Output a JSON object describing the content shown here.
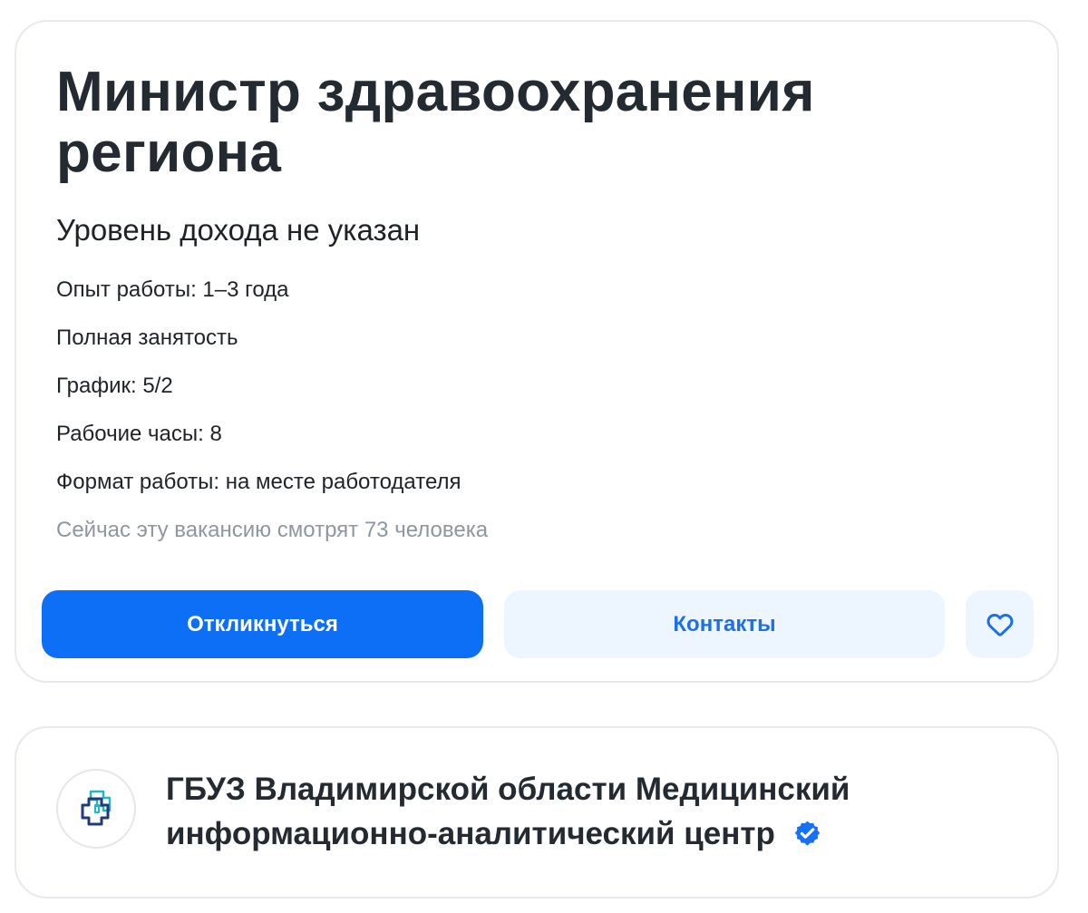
{
  "vacancy": {
    "title": "Министр здравоохранения региона",
    "income": "Уровень дохода не указан",
    "details": [
      "Опыт работы: 1–3 года",
      "Полная занятость",
      "График: 5/2",
      "Рабочие часы: 8",
      "Формат работы: на месте работодателя"
    ],
    "viewers": "Сейчас эту вакансию смотрят 73 человека",
    "actions": {
      "apply_label": "Откликнуться",
      "contacts_label": "Контакты",
      "favorite_icon": "heart-icon"
    }
  },
  "employer": {
    "name": "ГБУЗ Владимирской области Медицинский информационно-аналитический центр",
    "verified": true,
    "logo_icon": "medical-cross-logo",
    "verified_icon": "verified-badge-icon"
  },
  "colors": {
    "primary": "#0D6FF5",
    "secondary_bg": "#EDF5FF",
    "secondary_text": "#1C6FE7",
    "muted_text": "#8E96A2",
    "card_border": "#E7E9EE",
    "title_text": "#232A31"
  }
}
